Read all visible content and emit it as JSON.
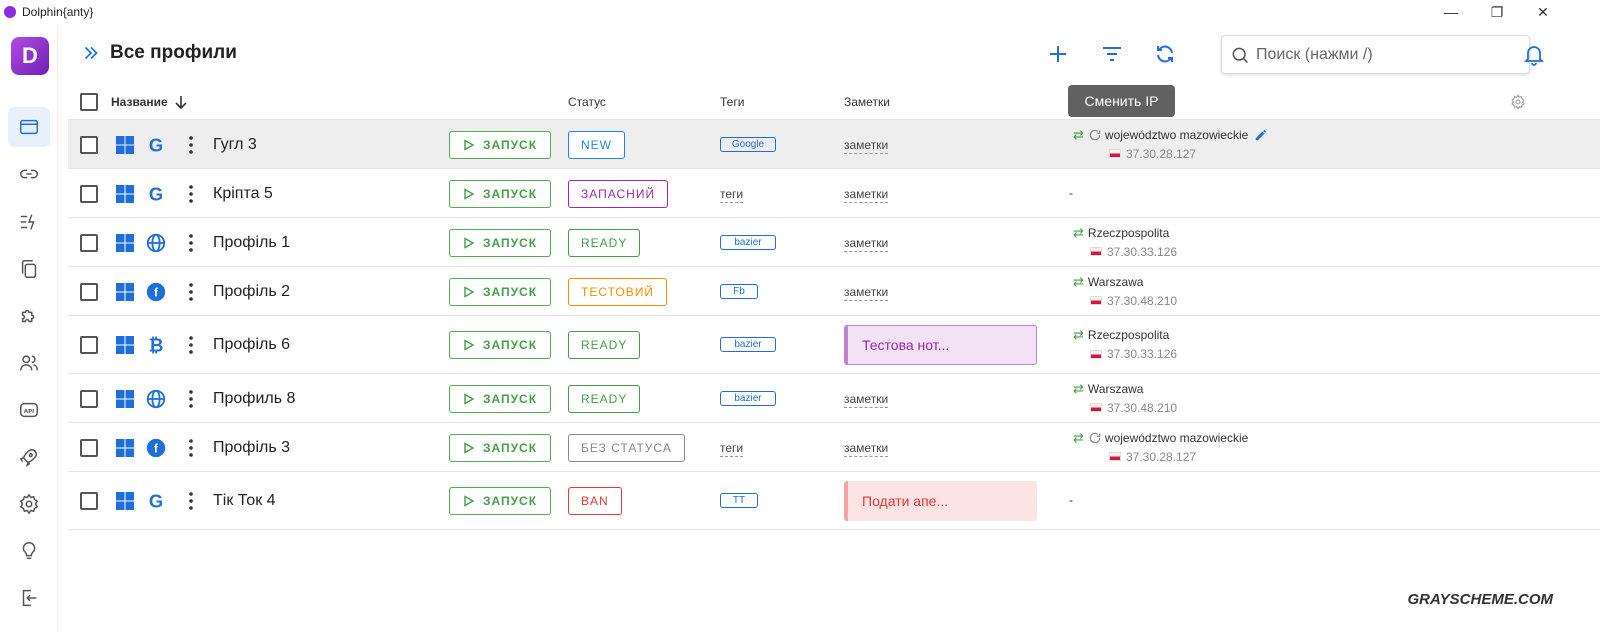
{
  "app": {
    "title": "Dolphin{anty}"
  },
  "header": {
    "title": "Все профили",
    "search_placeholder": "Поиск (нажми /)",
    "tooltip": "Сменить IP"
  },
  "columns": {
    "name": "Название",
    "status": "Статус",
    "tags": "Теги",
    "notes": "Заметки"
  },
  "launch_label": "ЗАПУСК",
  "rows": [
    {
      "name": "Гугл 3",
      "icon": "google-icon",
      "status": "NEW",
      "status_color": "#1e88e5",
      "tag": "Google",
      "tag_type": "chip",
      "note": "заметки",
      "note_type": "link",
      "proxy_name": "województwo mazowieckie",
      "proxy_ip": "37.30.28.127",
      "proxy_refresh": true,
      "proxy_edit": true
    },
    {
      "name": "Кріпта 5",
      "icon": "google-icon",
      "status": "ЗАПАСНИЙ",
      "status_color": "#9c27b0",
      "tag": "теги",
      "tag_type": "link",
      "note": "заметки",
      "note_type": "link",
      "proxy_name": "-",
      "proxy_ip": "",
      "proxy_refresh": false,
      "proxy_edit": false
    },
    {
      "name": "Профіль 1",
      "icon": "globe-icon",
      "status": "READY",
      "status_color": "#43a047",
      "tag": "bazier",
      "tag_type": "chip",
      "note": "заметки",
      "note_type": "link",
      "proxy_name": "Rzeczpospolita",
      "proxy_ip": "37.30.33.126",
      "proxy_refresh": false,
      "proxy_edit": false
    },
    {
      "name": "Профіль 2",
      "icon": "facebook-icon",
      "status": "ТЕСТОВИЙ",
      "status_color": "#fb8c00",
      "tag": "Fb",
      "tag_type": "chip",
      "note": "заметки",
      "note_type": "link",
      "proxy_name": "Warszawa",
      "proxy_ip": "37.30.48.210",
      "proxy_refresh": false,
      "proxy_edit": false
    },
    {
      "name": "Профіль 6",
      "icon": "bitcoin-icon",
      "status": "READY",
      "status_color": "#43a047",
      "tag": "bazier",
      "tag_type": "chip",
      "note": "Тестова нот...",
      "note_type": "box-purple",
      "proxy_name": "Rzeczpospolita",
      "proxy_ip": "37.30.33.126",
      "proxy_refresh": false,
      "proxy_edit": false
    },
    {
      "name": "Профиль 8",
      "icon": "globe-icon",
      "status": "READY",
      "status_color": "#43a047",
      "tag": "bazier",
      "tag_type": "chip",
      "note": "заметки",
      "note_type": "link",
      "proxy_name": "Warszawa",
      "proxy_ip": "37.30.48.210",
      "proxy_refresh": false,
      "proxy_edit": false
    },
    {
      "name": "Профіль 3",
      "icon": "facebook-icon",
      "status": "БЕЗ СТАТУСА",
      "status_color": "#888888",
      "tag": "теги",
      "tag_type": "link",
      "note": "заметки",
      "note_type": "link",
      "proxy_name": "województwo mazowieckie",
      "proxy_ip": "37.30.28.127",
      "proxy_refresh": true,
      "proxy_edit": false
    },
    {
      "name": "Тік Ток 4",
      "icon": "google-icon",
      "status": "BAN",
      "status_color": "#e53935",
      "tag": "TT",
      "tag_type": "chip",
      "note": "Подати апе...",
      "note_type": "box-red",
      "proxy_name": "-",
      "proxy_ip": "",
      "proxy_refresh": false,
      "proxy_edit": false
    }
  ],
  "watermark": "GRAYSCHEME.COM"
}
